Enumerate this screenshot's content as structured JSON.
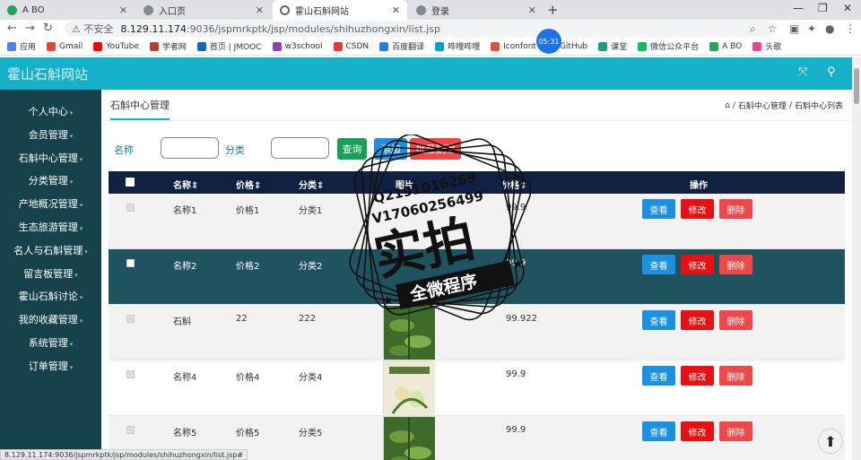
{
  "browser": {
    "tabs": [
      {
        "title": "A BO",
        "color": "#27a35a"
      },
      {
        "title": "入口页",
        "color": "#888888"
      },
      {
        "title": "霍山石斛网站",
        "color": "#888888"
      },
      {
        "title": "登录",
        "color": "#888888"
      }
    ],
    "insecure_label": "不安全",
    "url_host": "8.129.11.174",
    "url_path": ":9036/jspmrkptk/jsp/modules/shihuzhongxin/list.jsp",
    "bookmarks": [
      {
        "label": "应用",
        "color": "#4285f4"
      },
      {
        "label": "Gmail",
        "color": "#ea4335"
      },
      {
        "label": "YouTube",
        "color": "#ff0000"
      },
      {
        "label": "学者网",
        "color": "#c0392b"
      },
      {
        "label": "首页 | JMOOC",
        "color": "#1565c0"
      },
      {
        "label": "w3school",
        "color": "#8e44ad"
      },
      {
        "label": "CSDN",
        "color": "#e53935"
      },
      {
        "label": "百度翻译",
        "color": "#2979ff"
      },
      {
        "label": "哔哩哔哩",
        "color": "#00a1d6"
      },
      {
        "label": "Iconfont",
        "color": "#e74c3c"
      },
      {
        "label": "GitHub",
        "color": "#222222"
      },
      {
        "label": "课堂",
        "color": "#16a085"
      },
      {
        "label": "微信公众平台",
        "color": "#07c160"
      },
      {
        "label": "A BO",
        "color": "#27a35a"
      },
      {
        "label": "头歌",
        "color": "#e84393"
      }
    ],
    "timer": "05:31",
    "status_url": "8.129.11.174:9036/jspmrkptk/jsp/modules/shihuzhongxin/list.jsp#"
  },
  "site": {
    "title": "霍山石斛网站"
  },
  "sidebar": {
    "items": [
      {
        "label": "个人中心"
      },
      {
        "label": "会员管理"
      },
      {
        "label": "石斛中心管理"
      },
      {
        "label": "分类管理"
      },
      {
        "label": "产地概况管理"
      },
      {
        "label": "生态旅游管理"
      },
      {
        "label": "名人与石斛管理"
      },
      {
        "label": "留言板管理"
      },
      {
        "label": "霍山石斛讨论"
      },
      {
        "label": "我的收藏管理"
      },
      {
        "label": "系统管理"
      },
      {
        "label": "订单管理"
      }
    ]
  },
  "page": {
    "heading": "石斛中心管理",
    "breadcrumb": [
      "石斛中心管理",
      "石斛中心列表"
    ]
  },
  "search": {
    "name_label": "名称",
    "category_label": "分类",
    "query_button": "查询",
    "add_button": "添加",
    "batch_delete_button": "批量删除"
  },
  "table": {
    "headers": [
      "名称",
      "价格",
      "分类",
      "图片",
      "价格",
      "操作"
    ],
    "rows": [
      {
        "name": "名称1",
        "price": "价格1",
        "category": "分类1",
        "price2": "99.9",
        "image": false
      },
      {
        "name": "名称2",
        "price": "价格2",
        "category": "分类2",
        "price2": "99.9",
        "image": false
      },
      {
        "name": "石斛",
        "price": "22",
        "category": "222",
        "price2": "99.922",
        "image": true
      },
      {
        "name": "名称4",
        "price": "价格4",
        "category": "分类4",
        "price2": "99.9",
        "image": true
      },
      {
        "name": "名称5",
        "price": "价格5",
        "category": "分类5",
        "price2": "99.9",
        "image": true
      }
    ],
    "actions": {
      "view": "查看",
      "edit": "修改",
      "delete": "删除"
    }
  },
  "watermark": {
    "line1": "Q2191016269",
    "line2": "V17060256499",
    "main": "实拍",
    "sub": "全微程序"
  },
  "colors": {
    "header": "#16b0c9",
    "sidebar": "#17424c",
    "table_head": "#0f2040",
    "row_highlight": "#205360",
    "btn_view": "#1e90e0",
    "btn_edit": "#e81010",
    "btn_delete": "#f04848"
  }
}
